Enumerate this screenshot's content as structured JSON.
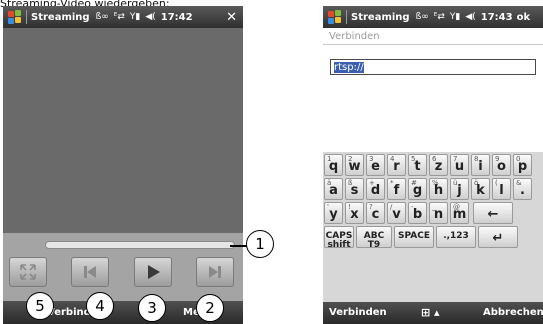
{
  "caption": "Streaming-Video wiedergeben:",
  "left_screen": {
    "title": "Streaming",
    "status_icons": [
      "bluetooth-icon",
      "data-connection-icon",
      "signal-icon",
      "speaker-icon"
    ],
    "time": "17:42",
    "close_label": "✕",
    "softkey_left": "Verbinden",
    "softkey_right": "Menü",
    "controls": [
      "fullscreen-button",
      "previous-button",
      "play-button",
      "next-button"
    ],
    "callouts": [
      "1",
      "2",
      "3",
      "4",
      "5"
    ]
  },
  "right_screen": {
    "title": "Streaming",
    "time": "17:43",
    "ok_label": "ok",
    "label": "Verbinden",
    "url_value": "rtsp://",
    "softkey_left": "Verbinden",
    "softkey_right": "Abbrechen",
    "keyboard": {
      "row1": [
        [
          "1",
          "q"
        ],
        [
          "2",
          "w"
        ],
        [
          "3",
          "e"
        ],
        [
          "4",
          "r"
        ],
        [
          "5",
          "t"
        ],
        [
          "6",
          "z"
        ],
        [
          "7",
          "u"
        ],
        [
          "8",
          "i"
        ],
        [
          "9",
          "o"
        ],
        [
          "0",
          "p"
        ]
      ],
      "row2": [
        [
          "ä",
          "a"
        ],
        [
          "ß",
          "s"
        ],
        [
          "+",
          "d"
        ],
        [
          "*",
          "f"
        ],
        [
          "#",
          "g"
        ],
        [
          "%",
          "h"
        ],
        [
          "ü",
          "j"
        ],
        [
          "ö",
          "k"
        ],
        [
          "(",
          "l"
        ],
        [
          "&",
          "."
        ]
      ],
      "row3": [
        [
          "'",
          "y"
        ],
        [
          "!",
          "x"
        ],
        [
          "?",
          "c"
        ],
        [
          "/",
          "v"
        ],
        [
          "-",
          "b"
        ],
        [
          "_",
          "n"
        ],
        [
          "@",
          "m"
        ]
      ],
      "row4": {
        "caps": "CAPS",
        "shift": "shift",
        "abc": "ABC",
        "t9": "T9",
        "space": "SPACE",
        "num": ".,123"
      }
    }
  }
}
